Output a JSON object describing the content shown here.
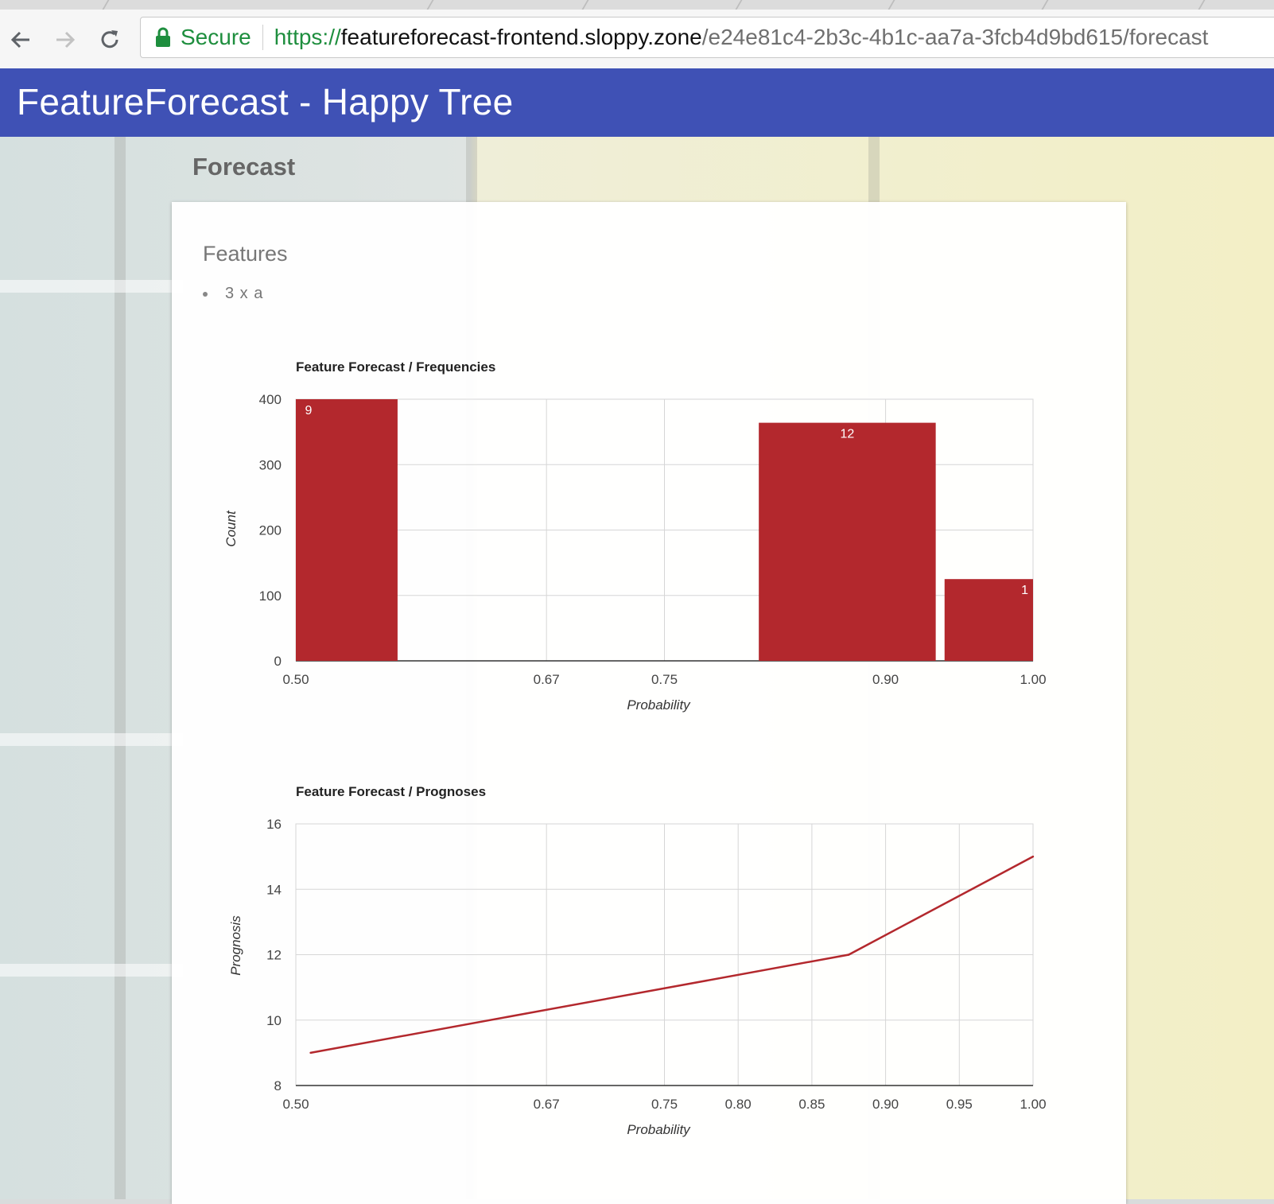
{
  "browser": {
    "secure_label": "Secure",
    "url_scheme": "https://",
    "url_host": "featureforecast-frontend.sloppy.zone",
    "url_path": "/e24e81c4-2b3c-4b1c-aa7a-3fcb4d9bd615/forecast"
  },
  "app": {
    "title": "FeatureForecast - Happy Tree",
    "bar_color": "#3f51b5"
  },
  "page": {
    "section_title": "Forecast",
    "features_heading": "Features",
    "features": [
      "3 x a"
    ]
  },
  "chart_data": [
    {
      "type": "bar",
      "title": "Feature Forecast / Frequencies",
      "xlabel": "Probability",
      "ylabel": "Count",
      "ylim": [
        0,
        400
      ],
      "yticks": [
        "0",
        "100",
        "200",
        "300",
        "400"
      ],
      "xlim": [
        0.5,
        1.0
      ],
      "xticks": [
        "0.50",
        "0.67",
        "0.75",
        "0.90",
        "1.00"
      ],
      "color": "#b3282d",
      "bars": [
        {
          "x_start": 0.5,
          "x_end": 0.569,
          "value": 400,
          "label": "9"
        },
        {
          "x_start": 0.814,
          "x_end": 0.934,
          "value": 364,
          "label": "12"
        },
        {
          "x_start": 0.94,
          "x_end": 1.0,
          "value": 125,
          "label": "1"
        }
      ]
    },
    {
      "type": "line",
      "title": "Feature Forecast / Prognoses",
      "xlabel": "Probability",
      "ylabel": "Prognosis",
      "ylim": [
        8,
        16
      ],
      "yticks": [
        "8",
        "10",
        "12",
        "14",
        "16"
      ],
      "xlim": [
        0.5,
        1.0
      ],
      "xticks": [
        "0.50",
        "0.67",
        "0.75",
        "0.80",
        "0.85",
        "0.90",
        "0.95",
        "1.00"
      ],
      "color": "#b3282d",
      "x": [
        0.51,
        0.875,
        1.0
      ],
      "y": [
        9,
        12,
        15
      ]
    }
  ]
}
